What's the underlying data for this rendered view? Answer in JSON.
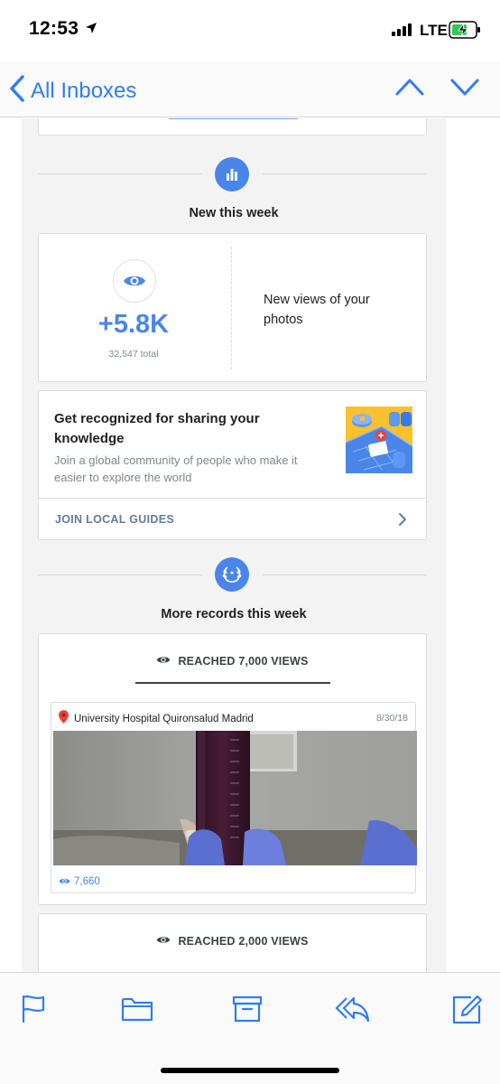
{
  "status_bar": {
    "time": "12:53",
    "network": "LTE"
  },
  "nav": {
    "back_label": "All Inboxes"
  },
  "new_this_week": {
    "title": "New this week",
    "views_delta": "+5.8K",
    "views_total": "32,547 total",
    "views_label": "New views of your photos"
  },
  "local_guides": {
    "title": "Get recognized for sharing your knowledge",
    "description": "Join a global community of people who make it easier to explore the world",
    "link_label": "JOIN LOCAL GUIDES"
  },
  "records": {
    "title": "More records this week",
    "items": [
      {
        "heading": "REACHED 7,000 VIEWS",
        "place": "University Hospital Quironsalud Madrid",
        "date": "8/30/18",
        "views": "7,660"
      },
      {
        "heading": "REACHED 2,000 VIEWS"
      }
    ]
  },
  "colors": {
    "accent": "#4a86e8",
    "ios_blue": "#2f7cf6",
    "background": "#f3f3f3"
  }
}
